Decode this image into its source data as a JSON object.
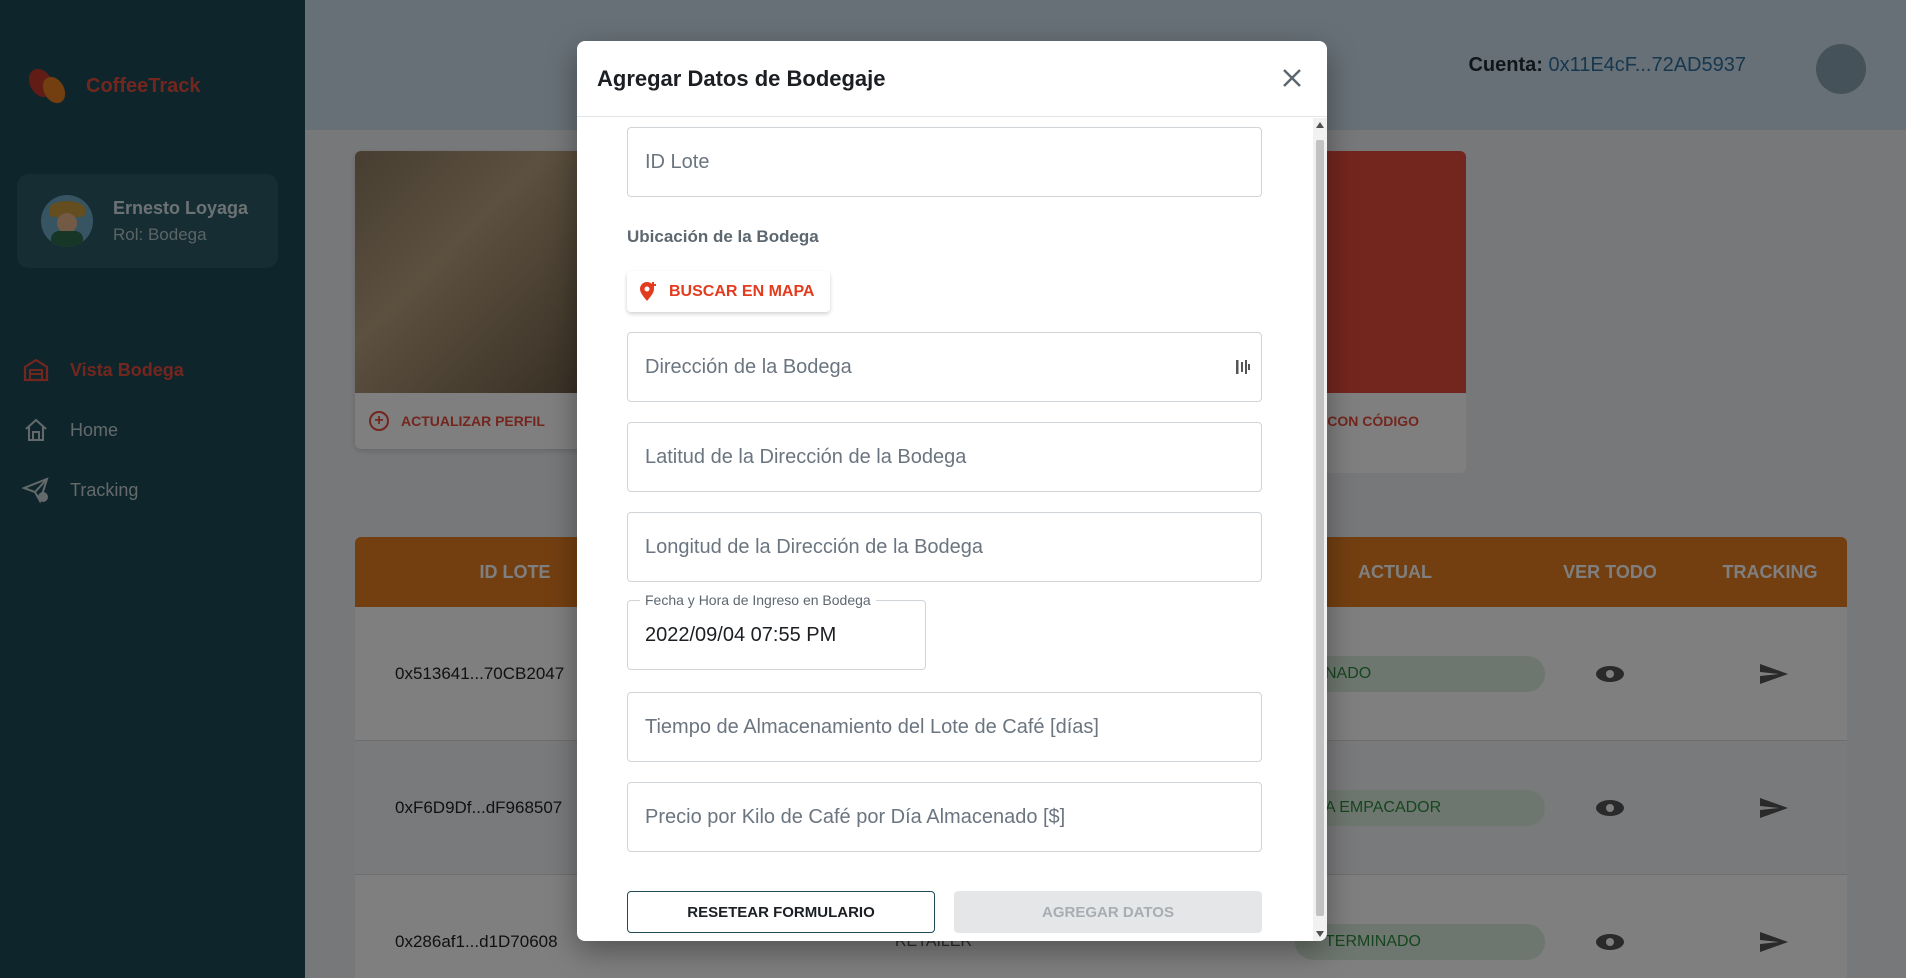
{
  "app": {
    "name": "CoffeeTrack"
  },
  "user": {
    "name": "Ernesto Loyaga",
    "role": "Rol: Bodega"
  },
  "sidebar": {
    "items": [
      {
        "label": "Vista Bodega",
        "icon": "warehouse-icon",
        "active": true
      },
      {
        "label": "Home",
        "icon": "home-icon",
        "active": false
      },
      {
        "label": "Tracking",
        "icon": "send-check-icon",
        "active": false
      }
    ]
  },
  "header": {
    "account_label": "Cuenta:",
    "account_value": "0x11E4cF...72AD5937"
  },
  "cards": {
    "left_action": "ACTUALIZAR PERFIL",
    "right_action": "E CON CÓDIGO"
  },
  "table": {
    "headers": [
      "ID LOTE",
      "ACTUAL",
      "VER TODO",
      "TRACKING"
    ],
    "rows": [
      {
        "id": "0x513641...70CB2047",
        "status": "NADO"
      },
      {
        "id": "0xF6D9Df...dF968507",
        "status": "A EMPACADOR"
      },
      {
        "id": "0x286af1...d1D70608",
        "status": "TERMINADO",
        "extra": "RETAILER"
      }
    ]
  },
  "modal": {
    "title": "Agregar Datos de Bodegaje",
    "fields": {
      "lote_placeholder": "ID Lote",
      "section_label": "Ubicación de la Bodega",
      "map_button": "BUSCAR EN MAPA",
      "address_placeholder": "Dirección de la Bodega",
      "lat_placeholder": "Latitud de la Dirección de la Bodega",
      "lng_placeholder": "Longitud de la Dirección de la Bodega",
      "date_label": "Fecha y Hora de Ingreso en Bodega",
      "date_value": "2022/09/04 07:55 PM",
      "storage_placeholder": "Tiempo de Almacenamiento del Lote de Café [días]",
      "price_placeholder": "Precio por Kilo de Café por Día Almacenado [$]"
    },
    "buttons": {
      "reset": "RESETEAR FORMULARIO",
      "add": "AGREGAR DATOS"
    }
  },
  "colors": {
    "sidebar_bg": "#1d4b57",
    "accent_red": "#e74c3c",
    "table_header": "#e67e22"
  }
}
